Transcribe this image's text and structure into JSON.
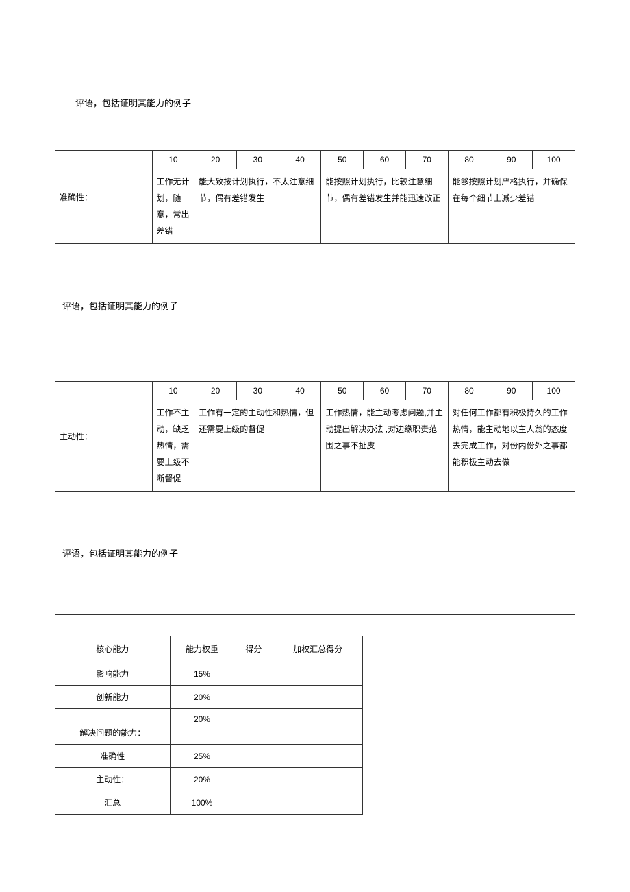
{
  "intro_comment": "评语，包括证明其能力的例子",
  "rubric1": {
    "label": "准确性：",
    "scores": [
      "10",
      "20",
      "30",
      "40",
      "50",
      "60",
      "70",
      "80",
      "90",
      "100"
    ],
    "descs": [
      "工作无计划，随意，常出差错",
      "能大致按计划执行，不太注意细节，偶有差错发生",
      "能按照计划执行，比较注意细节，偶有差错发生并能迅速改正",
      "能够按照计划严格执行，并确保在每个细节上减少差错"
    ],
    "comment_label": "评语，包括证明其能力的例子"
  },
  "rubric2": {
    "label": "主动性：",
    "scores": [
      "10",
      "20",
      "30",
      "40",
      "50",
      "60",
      "70",
      "80",
      "90",
      "100"
    ],
    "descs": [
      "工作不主动，缺乏热情，需要上级不断督促",
      "工作有一定的主动性和热情，但还需要上级的督促",
      "工作热情，能主动考虑问题,并主动提出解决办法 ,对边缘职责范围之事不扯皮",
      "对任何工作都有积极持久的工作热情，能主动地以主人翁的态度去完成工作，对份内份外之事都能积极主动去做"
    ],
    "comment_label": "评语，包括证明其能力的例子"
  },
  "summary": {
    "headers": [
      "核心能力",
      "能力权重",
      "得分",
      "加权汇总得分"
    ],
    "rows": [
      {
        "name": "影响能力",
        "weight": "15%",
        "score": "",
        "weighted": ""
      },
      {
        "name": "创新能力",
        "weight": "20%",
        "score": "",
        "weighted": ""
      },
      {
        "name": "解决问题的能力：",
        "weight": "20%",
        "score": "",
        "weighted": ""
      },
      {
        "name": "准确性",
        "weight": "25%",
        "score": "",
        "weighted": ""
      },
      {
        "name": "主动性：",
        "weight": "20%",
        "score": "",
        "weighted": ""
      },
      {
        "name": "汇总",
        "weight": "100%",
        "score": "",
        "weighted": ""
      }
    ]
  }
}
